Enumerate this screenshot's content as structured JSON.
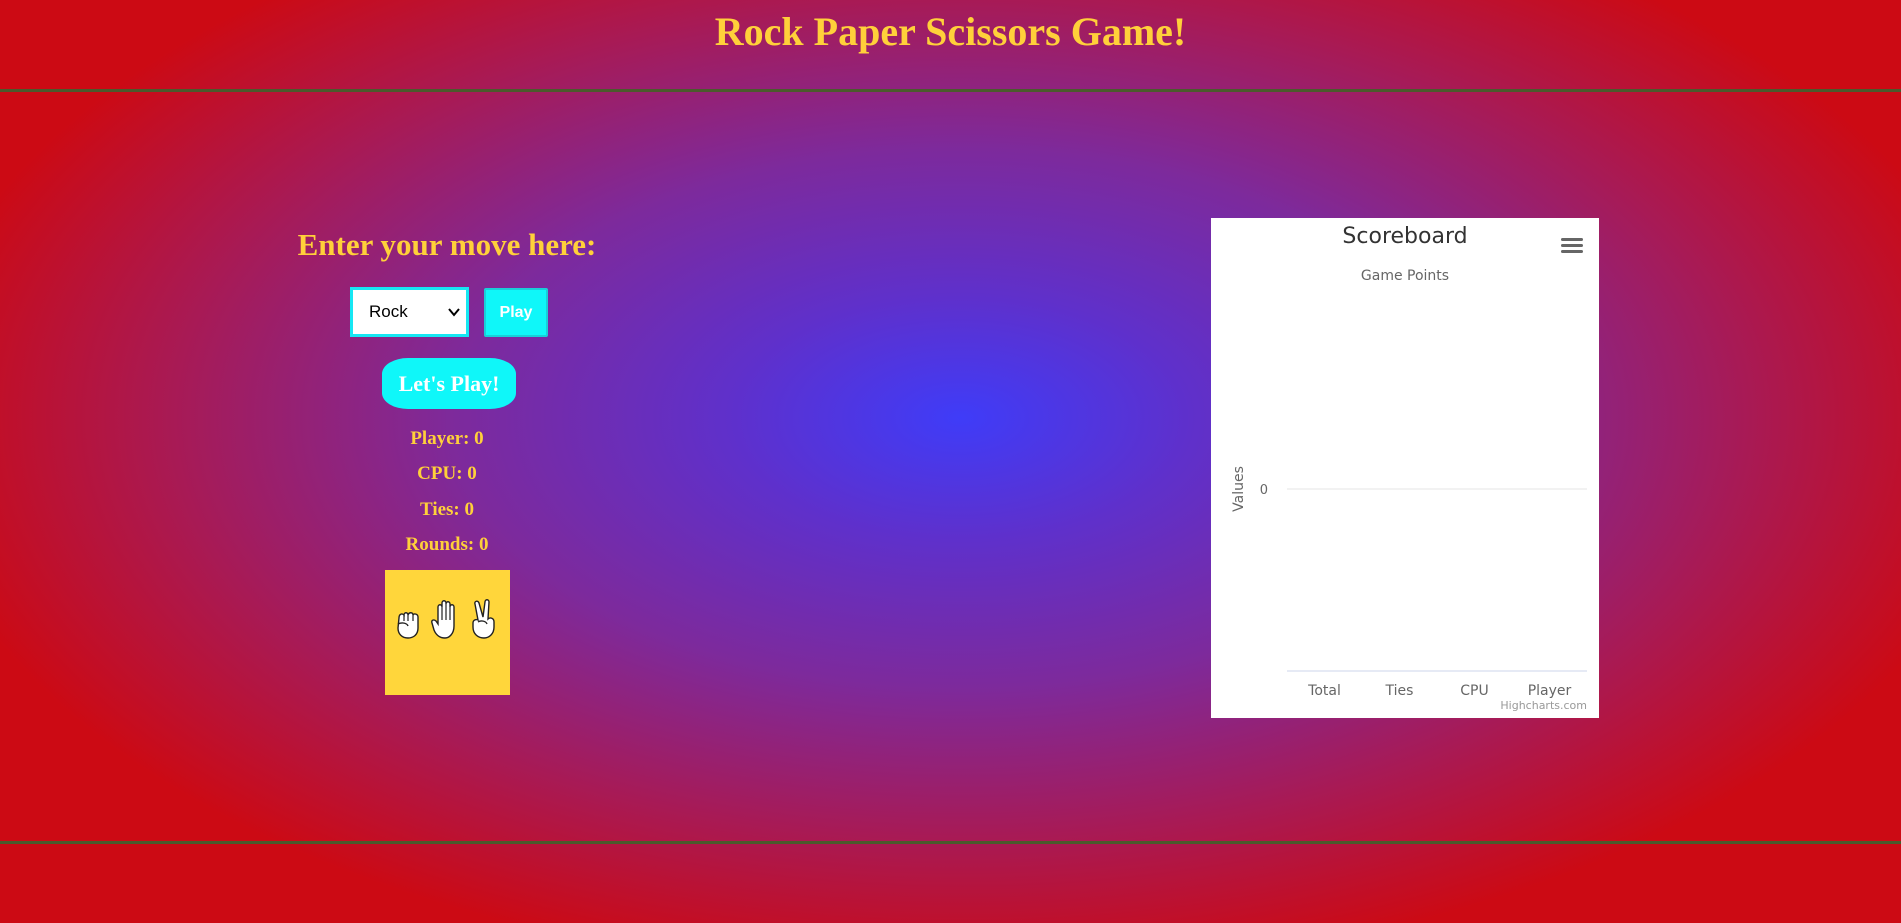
{
  "header": {
    "title": "Rock Paper Scissors Game!"
  },
  "game": {
    "move_prompt": "Enter your move here:",
    "selected_move": "Rock",
    "play_label": "Play",
    "lets_play_label": "Let's Play!",
    "player_score": "Player: 0",
    "cpu_score": "CPU: 0",
    "ties": "Ties: 0",
    "rounds": "Rounds: 0",
    "hands_icons": [
      "fist-icon",
      "open-hand-icon",
      "victory-hand-icon"
    ]
  },
  "chart": {
    "title": "Scoreboard",
    "subtitle": "Game Points",
    "credits": "Highcharts.com"
  },
  "chart_data": {
    "type": "bar",
    "title": "Scoreboard",
    "subtitle": "Game Points",
    "categories": [
      "Total",
      "Ties",
      "CPU",
      "Player"
    ],
    "values": [
      0,
      0,
      0,
      0
    ],
    "xlabel": "",
    "ylabel": "Values",
    "yticks": [
      "0"
    ],
    "grid": true
  },
  "colors": {
    "accent_yellow": "#ffd03a",
    "button_cyan": "#0ff7f9",
    "hands_box": "#ffd63b"
  }
}
